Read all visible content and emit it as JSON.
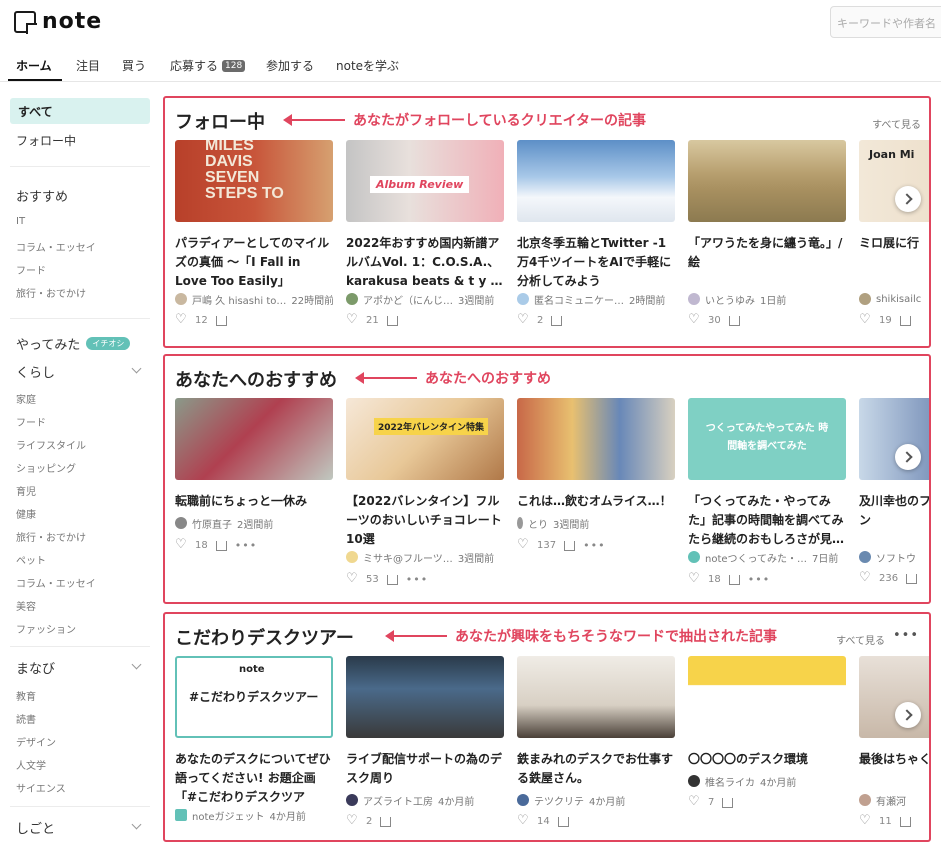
{
  "header": {
    "logo_text": "note",
    "search_placeholder": "キーワードや作者名"
  },
  "tabs": [
    {
      "label": "ホーム",
      "active": true
    },
    {
      "label": "注目"
    },
    {
      "label": "買う"
    },
    {
      "label": "応募する",
      "badge": "128"
    },
    {
      "label": "参加する"
    },
    {
      "label": "noteを学ぶ"
    }
  ],
  "sidebar": {
    "active": "すべて",
    "follow": "フォロー中",
    "groups": [
      {
        "title": "おすすめ",
        "items": [
          "IT",
          "コラム・エッセイ",
          "フード",
          "旅行・おでかけ"
        ]
      },
      {
        "title": "やってみた",
        "badge": "イチオシ"
      },
      {
        "title": "くらし",
        "items": [
          "家庭",
          "フード",
          "ライフスタイル",
          "ショッピング",
          "育児",
          "健康",
          "旅行・おでかけ",
          "ペット",
          "コラム・エッセイ",
          "美容",
          "ファッション"
        ]
      },
      {
        "title": "まなび",
        "items": [
          "教育",
          "読書",
          "デザイン",
          "人文学",
          "サイエンス"
        ]
      },
      {
        "title": "しごと"
      }
    ]
  },
  "sections": [
    {
      "title": "フォロー中",
      "annotation": "あなたがフォローしているクリエイターの記事",
      "see_all": "すべて見る",
      "cards": [
        {
          "title": "パラディアーとしてのマイルズの真価 〜「I Fall in Love Too Easily」",
          "author": "戸嶋 久 hisashi to…",
          "time": "22時間前",
          "likes": "12",
          "thumb_text": "MILES DAVIS SEVEN STEPS TO"
        },
        {
          "title": "2022年おすすめ国内新譜アルバムVol. 1：C.O.S.A.、karakusa beats & t y …",
          "author": "アポかど（にんじ…",
          "time": "3週間前",
          "likes": "21",
          "thumb_text": "Album Review"
        },
        {
          "title": "北京冬季五輪とTwitter -1万4千ツイートをAIで手軽に分析してみよう",
          "author": "匿名コミュニケー…",
          "time": "2時間前",
          "likes": "2"
        },
        {
          "title": "「アワうたを身に纏う竜。」/絵",
          "author": "いとうゆみ",
          "time": "1日前",
          "likes": "30"
        },
        {
          "title": "ミロ展に行",
          "author": "shikisailc",
          "time": "",
          "likes": "19",
          "thumb_text": "Joan Mi"
        }
      ]
    },
    {
      "title": "あなたへのおすすめ",
      "annotation": "あなたへのおすすめ",
      "cards": [
        {
          "title": "転職前にちょっと一休み",
          "author": "竹原直子",
          "time": "2週間前",
          "likes": "18"
        },
        {
          "title": "【2022バレンタイン】フルーツのおいしいチョコレート10選",
          "author": "ミサキ@フルーツ…",
          "time": "3週間前",
          "likes": "53",
          "thumb_text": "2022年バレンタイン特集"
        },
        {
          "title": "これは…飲むオムライス…！",
          "author": "とり",
          "time": "3週間前",
          "likes": "137"
        },
        {
          "title": "「つくってみた・やってみた」記事の時間軸を調べてみたら継続のおもしろさが見…",
          "author": "noteつくってみた・…",
          "time": "7日前",
          "likes": "18",
          "thumb_text": "つくってみたやってみた 時間軸を調べてみた"
        },
        {
          "title": "及川幸也のファースト」ターン",
          "author": "ソフトウ",
          "time": "",
          "likes": "236"
        }
      ]
    },
    {
      "title": "こだわりデスクツアー",
      "annotation": "あなたが興味をもちそうなワードで抽出された記事",
      "see_all": "すべて見る",
      "cards": [
        {
          "title": "あなたのデスクについてぜひ語ってください! お題企画「#こだわりデスクツアー」…",
          "author": "noteガジェット",
          "time": "4か月前",
          "likes": "",
          "thumb_text": "#こだわりデスクツアー",
          "thumb_logo": "note"
        },
        {
          "title": "ライブ配信サポートの為のデスク周り",
          "author": "アズライト工房",
          "time": "4か月前",
          "likes": "2"
        },
        {
          "title": "鉄まみれのデスクでお仕事する鉄屋さん。",
          "author": "テツクリテ",
          "time": "4か月前",
          "likes": "14"
        },
        {
          "title": "〇〇〇〇のデスク環境",
          "author": "椎名ライカ",
          "time": "4か月前",
          "likes": "7"
        },
        {
          "title": "最後はちゃく",
          "author": "有瀬河",
          "time": "",
          "likes": "11"
        }
      ]
    }
  ],
  "colors": {
    "accent": "#e0455e",
    "active_bg": "#d9f2ef",
    "badge_green": "#62c1b7"
  }
}
